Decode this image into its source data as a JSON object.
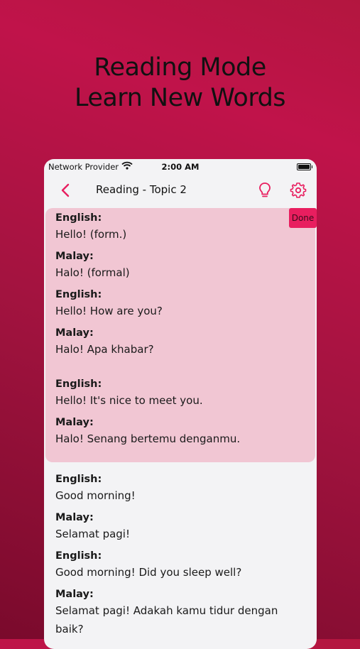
{
  "headline": {
    "line1": "Reading Mode",
    "line2": "Learn New Words"
  },
  "status_bar": {
    "carrier": "Network Provider",
    "time": "2:00 AM"
  },
  "nav": {
    "title": "Reading - Topic 2"
  },
  "done_label": "Done",
  "block1": [
    {
      "label": "English:",
      "text": "Hello! (form.)"
    },
    {
      "label": "Malay:",
      "text": "Halo! (formal)"
    },
    {
      "label": "English:",
      "text": "Hello! How are you?"
    },
    {
      "label": "Malay:",
      "text": "Halo! Apa khabar?"
    },
    {
      "label": "English:",
      "text": "Hello! It's nice to meet you."
    },
    {
      "label": "Malay:",
      "text": "Halo! Senang bertemu denganmu."
    }
  ],
  "block2": [
    {
      "label": "English:",
      "text": "Good morning!"
    },
    {
      "label": "Malay:",
      "text": "Selamat pagi!"
    },
    {
      "label": "English:",
      "text": "Good morning! Did you sleep well?"
    },
    {
      "label": "Malay:",
      "text": "Selamat pagi! Adakah kamu tidur dengan"
    },
    {
      "label": "",
      "text": "baik?"
    }
  ],
  "colors": {
    "accent": "#e81e5f",
    "highlight": "#f1c6d3",
    "background": "#b3163f"
  }
}
